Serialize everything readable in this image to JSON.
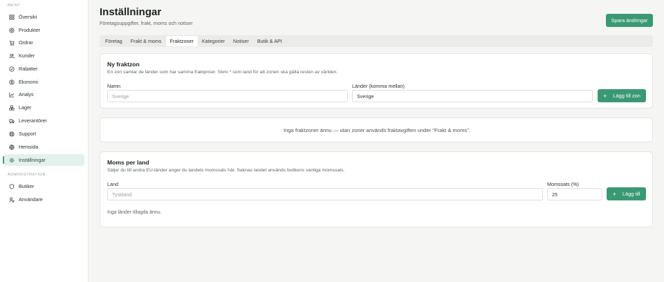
{
  "sidebar": {
    "section_menu": "MENY",
    "section_admin": "ADMINISTRATION",
    "items": [
      {
        "label": "Översikt",
        "icon": "grid-icon"
      },
      {
        "label": "Produkter",
        "icon": "package-icon"
      },
      {
        "label": "Ordrar",
        "icon": "cart-icon"
      },
      {
        "label": "Kunder",
        "icon": "users-icon"
      },
      {
        "label": "Rabatter",
        "icon": "discount-icon"
      },
      {
        "label": "Ekonomi",
        "icon": "dollar-icon"
      },
      {
        "label": "Analys",
        "icon": "chart-icon"
      },
      {
        "label": "Lager",
        "icon": "boxes-icon"
      },
      {
        "label": "Leverantörer",
        "icon": "truck-icon"
      },
      {
        "label": "Support",
        "icon": "lifebuoy-icon"
      },
      {
        "label": "Hemsida",
        "icon": "globe-icon"
      },
      {
        "label": "Inställningar",
        "icon": "gear-icon",
        "active": true
      }
    ],
    "admin_items": [
      {
        "label": "Butiker",
        "icon": "shield-icon"
      },
      {
        "label": "Användare",
        "icon": "user-cog-icon"
      }
    ]
  },
  "header": {
    "title": "Inställningar",
    "subtitle": "Företagsuppgifter, frakt, moms och notiser",
    "save_label": "Spara ändringar"
  },
  "tabs": [
    {
      "label": "Företag"
    },
    {
      "label": "Frakt & moms"
    },
    {
      "label": "Fraktzoner",
      "active": true
    },
    {
      "label": "Kategorier"
    },
    {
      "label": "Notiser"
    },
    {
      "label": "Butik & API"
    }
  ],
  "zone_card": {
    "title": "Ny fraktzon",
    "description": "En zon samlar de länder som har samma fraktpriser. Skriv * som land för att zonen ska gälla resten av världen.",
    "name_label": "Namn",
    "name_placeholder": "Sverige",
    "countries_label": "Länder (komma mellan)",
    "countries_value": "Sverige",
    "add_label": "Lägg till zon"
  },
  "empty_zones": "Inga fraktzoner ännu — utan zoner används fraktavgiften under \"Frakt & moms\".",
  "vat_card": {
    "title": "Moms per land",
    "description": "Säljer du till andra EU-länder anger du landets momssats här. Saknas landet används butikens vanliga momssats.",
    "country_label": "Land",
    "country_placeholder": "Tyskland",
    "rate_label": "Momssats (%)",
    "rate_value": "25",
    "add_label": "Lägg till",
    "empty": "Inga länder tillagda ännu."
  },
  "colors": {
    "accent": "#3a9973",
    "active_bg": "#e3f1ea"
  }
}
